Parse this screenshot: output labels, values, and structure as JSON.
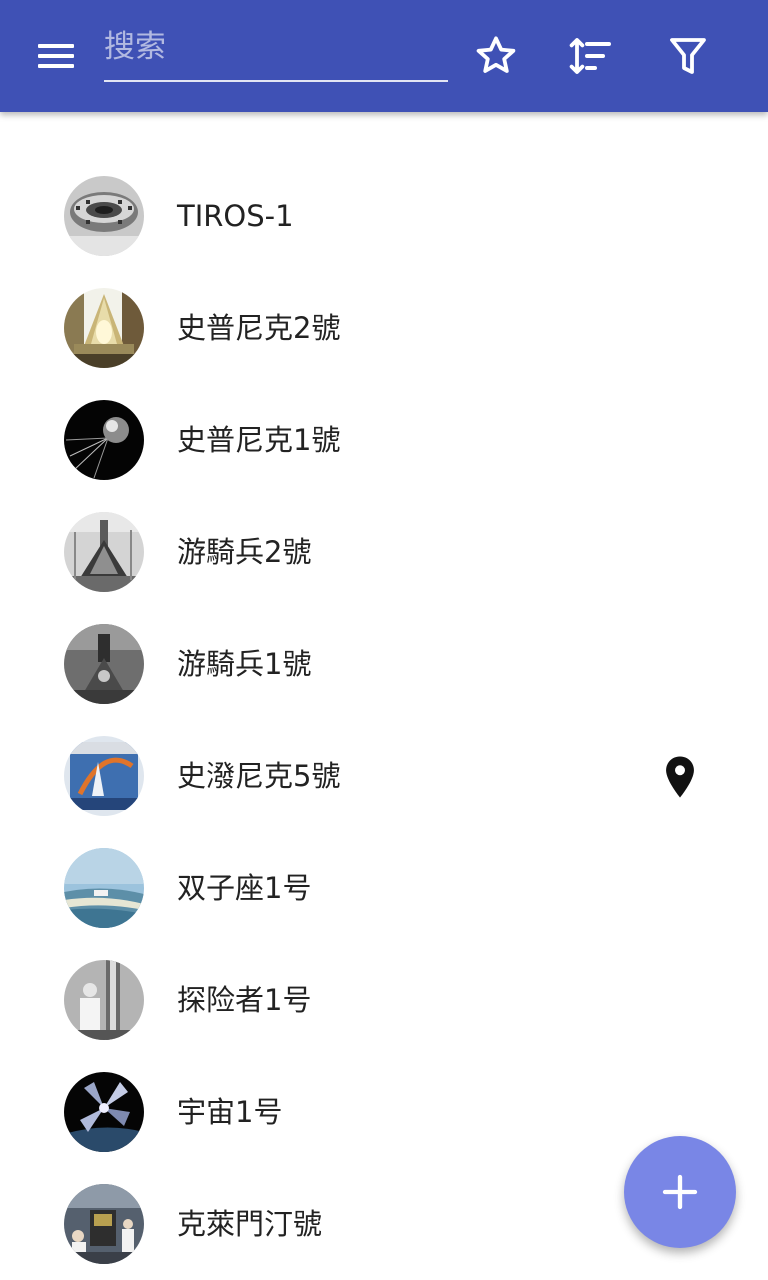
{
  "header": {
    "search_placeholder": "搜索",
    "search_value": "",
    "icons": [
      "menu-icon",
      "star-icon",
      "sort-icon",
      "filter-icon"
    ]
  },
  "colors": {
    "appbar": "#3f51b5",
    "fab": "#7986e6",
    "text": "#222222"
  },
  "items": [
    {
      "name": "TIROS-1",
      "has_location": false
    },
    {
      "name": "史普尼克2號",
      "has_location": false
    },
    {
      "name": "史普尼克1號",
      "has_location": false
    },
    {
      "name": "游騎兵2號",
      "has_location": false
    },
    {
      "name": "游騎兵1號",
      "has_location": false
    },
    {
      "name": "史潑尼克5號",
      "has_location": true
    },
    {
      "name": "双子座1号",
      "has_location": false
    },
    {
      "name": "探险者1号",
      "has_location": false
    },
    {
      "name": "宇宙1号",
      "has_location": false
    },
    {
      "name": "克萊門汀號",
      "has_location": false
    }
  ],
  "fab": {
    "icon": "plus-icon"
  }
}
